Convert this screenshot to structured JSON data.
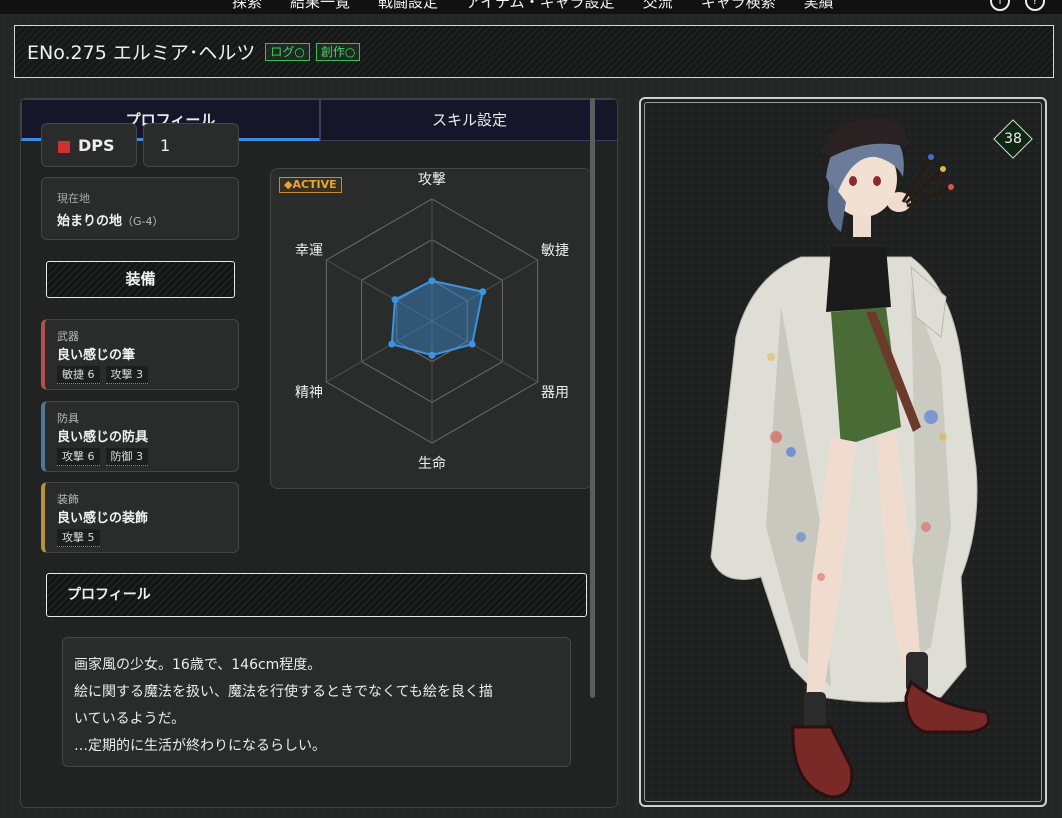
{
  "nav": {
    "items": [
      "探索",
      "結果一覧",
      "戦闘設定",
      "アイテム・キャラ設定",
      "交流",
      "キャラ検索",
      "実績"
    ],
    "icons": [
      "info-icon",
      "help-icon"
    ]
  },
  "header": {
    "title": "ENo.275 エルミア･ヘルツ",
    "tags": [
      "ログ○",
      "創作○"
    ]
  },
  "tabs": [
    "プロフィール",
    "スキル設定"
  ],
  "role": {
    "label": "DPS",
    "color": "#d03030",
    "value": "1"
  },
  "location": {
    "label": "現在地",
    "name": "始まりの地",
    "code": "（G-4）"
  },
  "equipment": {
    "heading": "装備",
    "items": [
      {
        "type": "武器",
        "name": "良い感じの筆",
        "color": "#b05050",
        "stats": [
          "敏捷 6",
          "攻撃 3"
        ]
      },
      {
        "type": "防具",
        "name": "良い感じの防具",
        "color": "#4f7796",
        "stats": [
          "攻撃 6",
          "防御 3"
        ]
      },
      {
        "type": "装飾",
        "name": "良い感じの装飾",
        "color": "#b8923a",
        "stats": [
          "攻撃 5"
        ]
      }
    ]
  },
  "radar": {
    "badge": "◆ACTIVE",
    "axes": [
      "攻撃",
      "敏捷",
      "器用",
      "生命",
      "精神",
      "幸運"
    ],
    "values": [
      0.33,
      0.48,
      0.38,
      0.28,
      0.38,
      0.35
    ]
  },
  "profile": {
    "heading": "プロフィール",
    "lines": [
      "画家風の少女。16歳で、146cm程度。",
      "絵に関する魔法を扱い、魔法を行使するときでなくても絵を良く描",
      "いているようだ。",
      "…定期的に生活が終わりになるらしい。"
    ]
  },
  "character": {
    "level": "38"
  }
}
